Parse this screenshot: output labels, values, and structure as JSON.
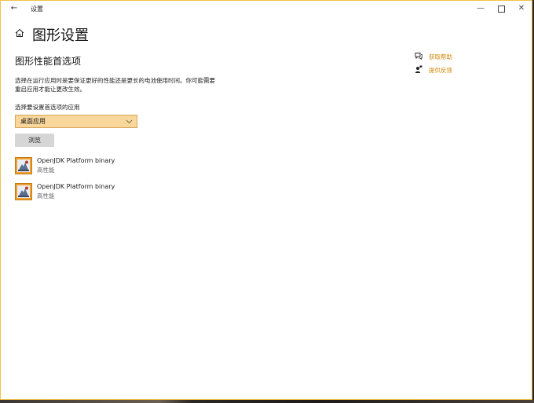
{
  "window": {
    "title": "设置",
    "back_glyph": "←",
    "minimize_glyph": "—",
    "close_glyph": "✕"
  },
  "page": {
    "title": "图形设置"
  },
  "section": {
    "title": "图形性能首选项",
    "description": "选择在运行应用时是要保证更好的性能还是更长的电池使用时间。你可能需要重启应用才能让更改生效。"
  },
  "select": {
    "label": "选择要设置首选项的应用",
    "value": "桌面应用"
  },
  "browse_button": "浏览",
  "apps": [
    {
      "name": "OpenJDK Platform binary",
      "preference": "高性能"
    },
    {
      "name": "OpenJDK Platform binary",
      "preference": "高性能"
    }
  ],
  "side_links": {
    "help": "获取帮助",
    "feedback": "提供反馈"
  },
  "colors": {
    "accent": "#d4880c",
    "select_bg": "#f9d69a",
    "window_border": "#f0c24a"
  },
  "icons": {
    "home": "home-icon",
    "help": "chat-help-icon",
    "feedback": "person-feedback-icon",
    "app": "java-app-icon"
  }
}
